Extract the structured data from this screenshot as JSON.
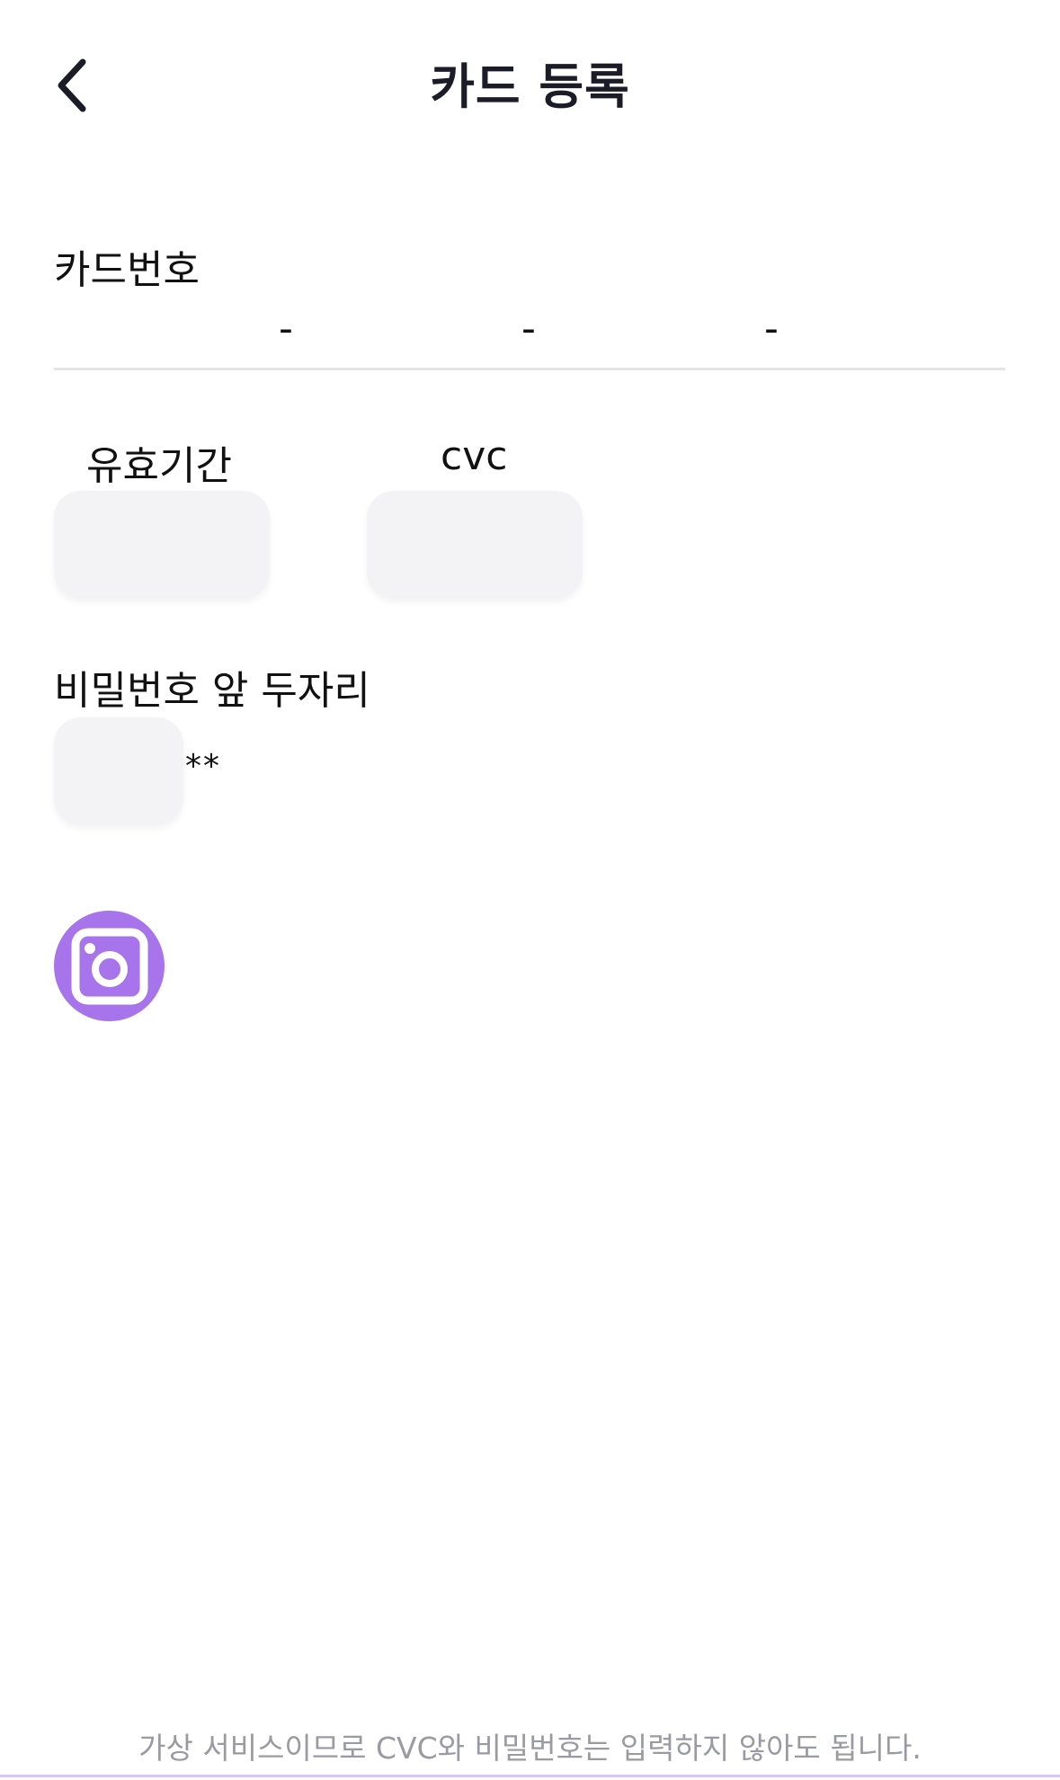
{
  "header": {
    "title": "카드 등록",
    "back_icon": "chevron-left-icon"
  },
  "card_number": {
    "label": "카드번호",
    "separator": "-",
    "segments": [
      "",
      "",
      "",
      ""
    ]
  },
  "expiry": {
    "label": "유효기간",
    "value": ""
  },
  "cvc": {
    "label": "cvc",
    "value": ""
  },
  "password": {
    "label": "비밀번호 앞 두자리",
    "value": "",
    "mask": "**"
  },
  "camera": {
    "icon": "camera-icon",
    "color": "#a774ec"
  },
  "footer": {
    "note": "가상 서비스이므로 CVC와 비밀번호는 입력하지 않아도 됩니다."
  }
}
